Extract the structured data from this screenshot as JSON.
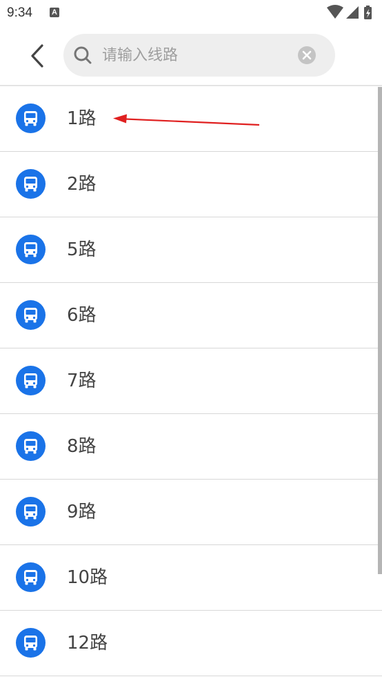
{
  "status_bar": {
    "time": "9:34",
    "notification_letter": "A"
  },
  "search": {
    "placeholder": "请输入线路",
    "value": ""
  },
  "routes": [
    {
      "label": "1路"
    },
    {
      "label": "2路"
    },
    {
      "label": "5路"
    },
    {
      "label": "6路"
    },
    {
      "label": "7路"
    },
    {
      "label": "8路"
    },
    {
      "label": "9路"
    },
    {
      "label": "10路"
    },
    {
      "label": "12路"
    }
  ],
  "icons": {
    "back": "chevron-left-icon",
    "search": "search-icon",
    "clear": "clear-icon",
    "route": "bus-icon"
  },
  "colors": {
    "accent": "#1a73e8",
    "annotation": "#e02020"
  }
}
